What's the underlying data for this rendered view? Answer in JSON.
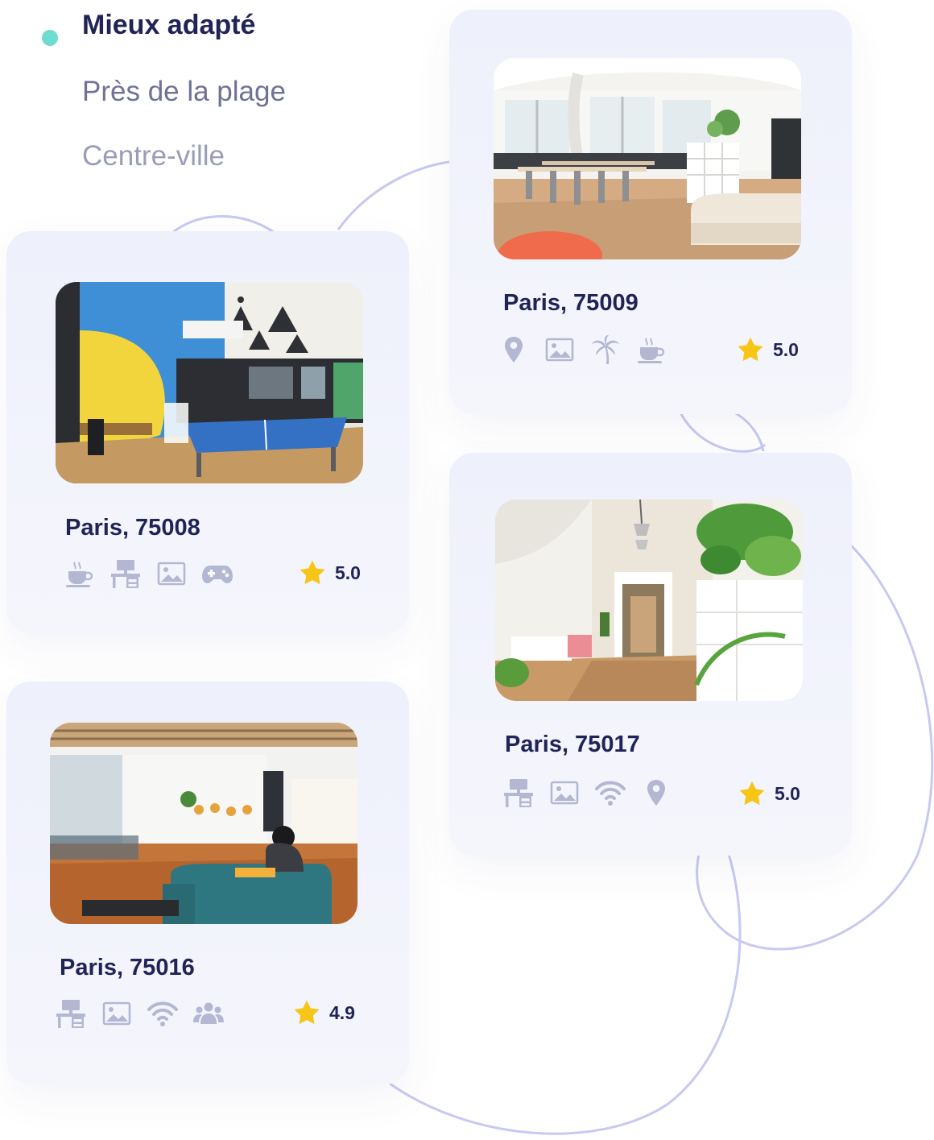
{
  "colors": {
    "accent_dot": "#6fdcd2",
    "title": "#1f2356",
    "icon": "#b4b7d2",
    "star": "#f7c515",
    "card_bg": "#eef0fb",
    "decor_line": "#c7c9f3"
  },
  "filters": [
    {
      "label": "Mieux adapté",
      "active": true
    },
    {
      "label": "Près de la plage",
      "active": false
    },
    {
      "label": "Centre-ville",
      "active": false
    }
  ],
  "cards": [
    {
      "title": "Paris, 75009",
      "rating": "5.0",
      "photo": "coworking-loft-photo",
      "amenities": [
        "location-pin-icon",
        "image-icon",
        "palm-tree-icon",
        "coffee-cup-icon"
      ]
    },
    {
      "title": "Paris, 75008",
      "rating": "5.0",
      "photo": "ping-pong-room-photo",
      "amenities": [
        "coffee-cup-icon",
        "desk-icon",
        "image-icon",
        "gamepad-icon"
      ]
    },
    {
      "title": "Paris, 75017",
      "rating": "5.0",
      "photo": "plant-hallway-photo",
      "amenities": [
        "desk-icon",
        "image-icon",
        "wifi-icon",
        "location-pin-icon"
      ]
    },
    {
      "title": "Paris, 75016",
      "rating": "4.9",
      "photo": "lounge-office-photo",
      "amenities": [
        "desk-icon",
        "image-icon",
        "wifi-icon",
        "group-icon"
      ]
    }
  ]
}
